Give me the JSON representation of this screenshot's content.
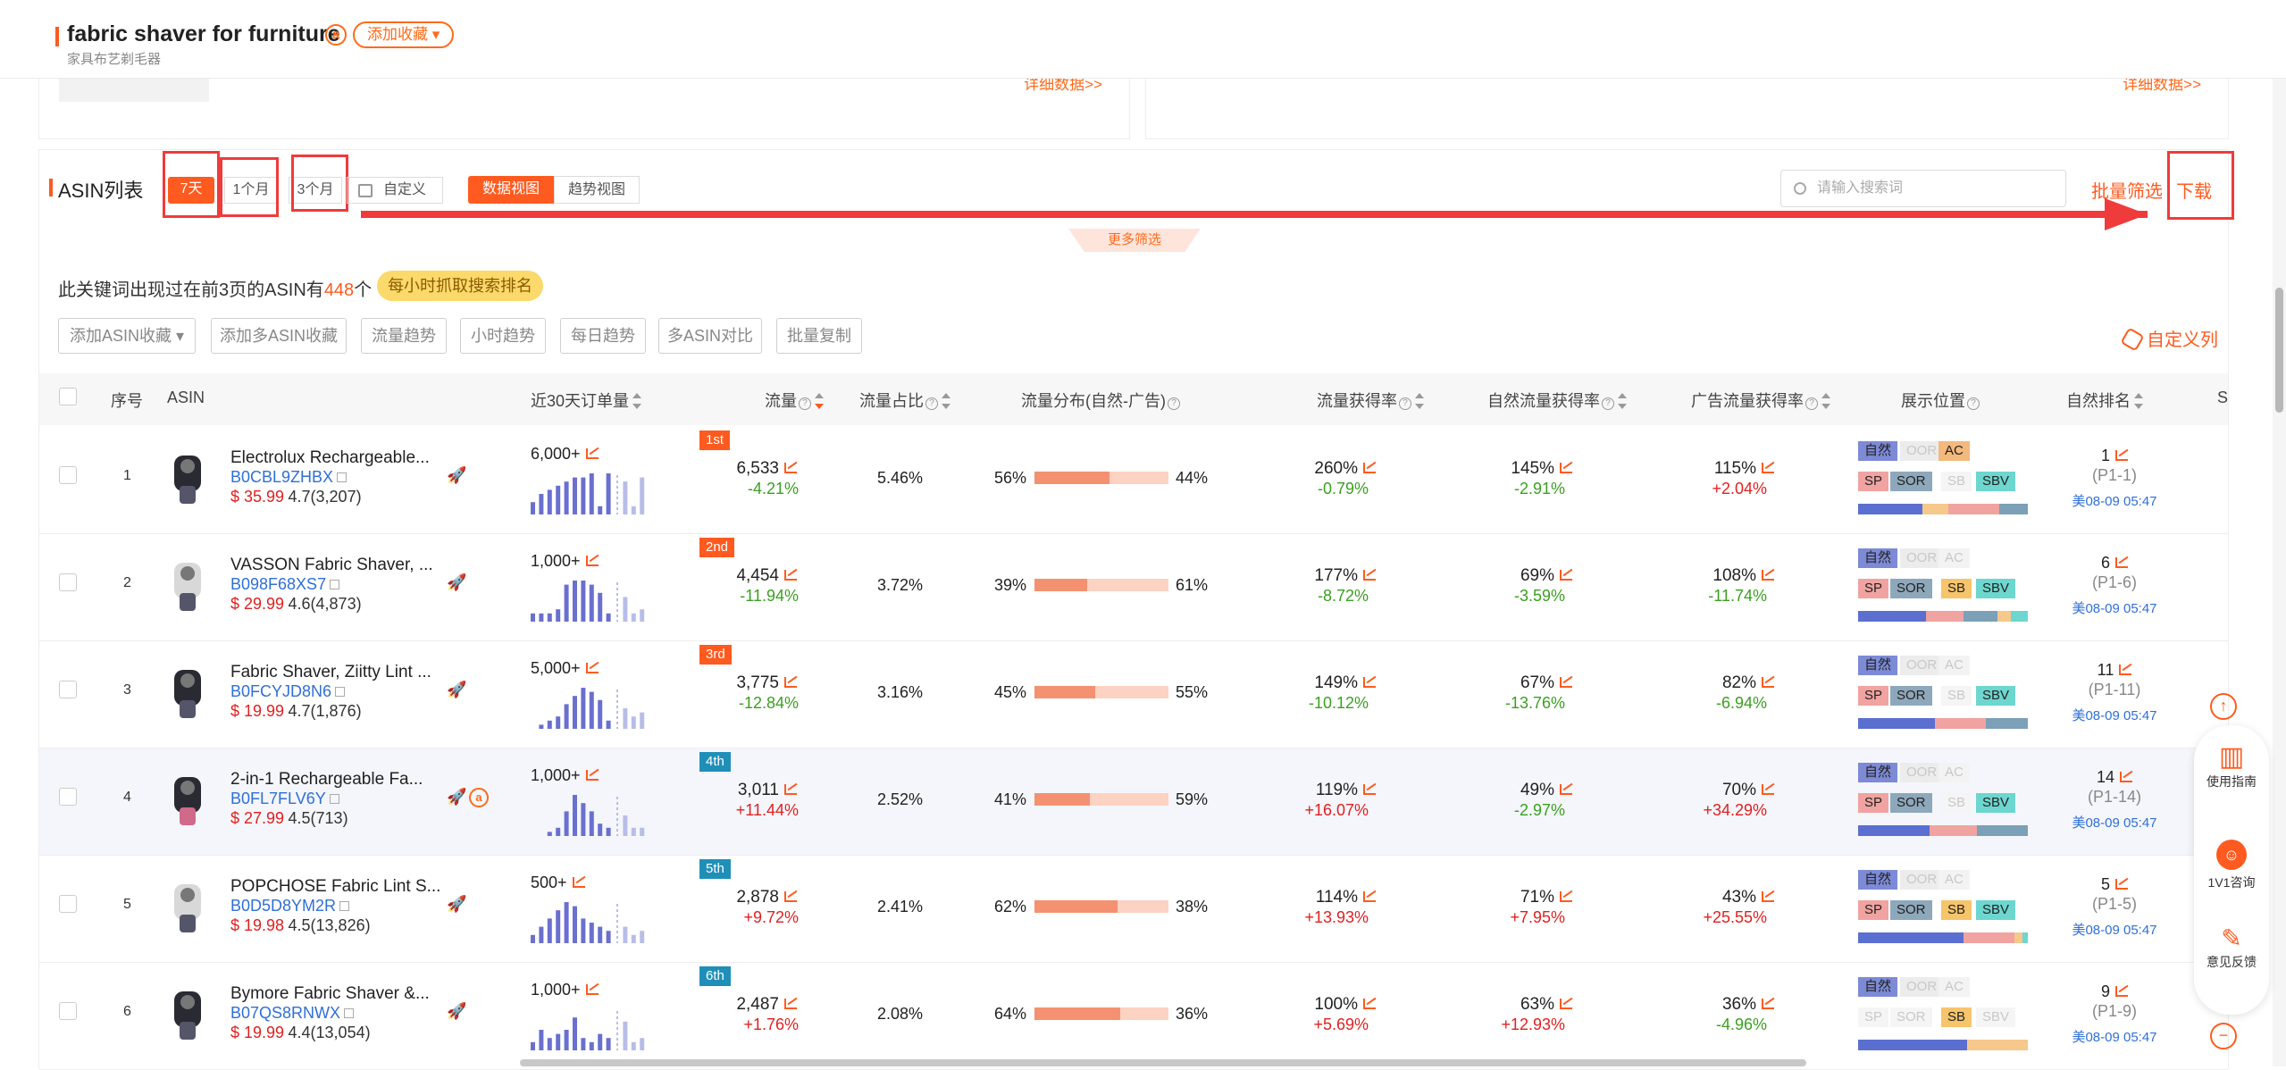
{
  "header": {
    "keyword": "fabric shaver for furniture",
    "badge": "a",
    "fav_label": "添加收藏",
    "subtitle": "家具布艺剃毛器"
  },
  "top_cards": {
    "detail_link": "详细数据>>"
  },
  "asin_section": {
    "title": "ASIN列表",
    "ranges": [
      "7天",
      "1个月",
      "3个月"
    ],
    "custom": "自定义",
    "views": [
      "数据视图",
      "趋势视图"
    ],
    "search_placeholder": "请输入搜索词",
    "bulk_filter": "批量筛选",
    "download": "下载",
    "more_filter": "更多筛选",
    "info_prefix": "此关键词出现过在前3页的ASIN有",
    "info_count": "448",
    "info_suffix": "个",
    "hourly_badge": "每小时抓取搜索排名",
    "actions": [
      "添加ASIN收藏",
      "添加多ASIN收藏",
      "流量趋势",
      "小时趋势",
      "每日趋势",
      "多ASIN对比",
      "批量复制"
    ],
    "custom_cols": "自定义列"
  },
  "columns": [
    "序号",
    "ASIN",
    "近30天订单量",
    "流量",
    "流量占比",
    "流量分布(自然-广告)",
    "流量获得率",
    "自然流量获得率",
    "广告流量获得率",
    "展示位置",
    "自然排名",
    "S"
  ],
  "position_tags": {
    "row1": [
      "自然",
      "OOR",
      "AC"
    ],
    "row2": [
      "SP",
      "SOR",
      "SB",
      "SBV"
    ]
  },
  "rows": [
    {
      "idx": "1",
      "title": "Electrolux Rechargeable...",
      "asin": "B0CBL9ZHBX",
      "price": "$ 35.99",
      "rating": "4.7(3,207)",
      "sales": "6,000+",
      "rank": "1st",
      "rank_color": "#ff5a1f",
      "traffic": "6,533",
      "traffic_chg": "-4.21%",
      "share": "5.46%",
      "dist_l": "56%",
      "dist_r": "44%",
      "dist_frac": 0.56,
      "r1": "260%",
      "r1c": "-0.79%",
      "r2": "145%",
      "r2c": "-2.91%",
      "r3": "115%",
      "r3c": "+2.04%",
      "nrank": "1",
      "np": "(P1-1)",
      "date": "美08-09 05:47",
      "bars": [
        3,
        5,
        6,
        7,
        8,
        9,
        9,
        10,
        2,
        10,
        0,
        8,
        2,
        9
      ],
      "tags_on": [
        1,
        0,
        1,
        1,
        1,
        0,
        1
      ],
      "pbar": [
        [
          "#5b6fd0",
          0.38
        ],
        [
          "#f6c88b",
          0.15
        ],
        [
          "#f0a3a0",
          0.3
        ],
        [
          "#7ba0b8",
          0.17
        ]
      ]
    },
    {
      "idx": "2",
      "title": "VASSON Fabric Shaver, ...",
      "asin": "B098F68XS7",
      "price": "$ 29.99",
      "rating": "4.6(4,873)",
      "sales": "1,000+",
      "rank": "2nd",
      "rank_color": "#ff5a1f",
      "traffic": "4,454",
      "traffic_chg": "-11.94%",
      "share": "3.72%",
      "dist_l": "39%",
      "dist_r": "61%",
      "dist_frac": 0.39,
      "r1": "177%",
      "r1c": "-8.72%",
      "r2": "69%",
      "r2c": "-3.59%",
      "r3": "108%",
      "r3c": "-11.74%",
      "nrank": "6",
      "np": "(P1-6)",
      "date": "美08-09 05:47",
      "bars": [
        2,
        2,
        2,
        3,
        9,
        10,
        10,
        9,
        7,
        2,
        0,
        6,
        2,
        3
      ],
      "tags_on": [
        1,
        0,
        0,
        1,
        1,
        1,
        1
      ],
      "pbar": [
        [
          "#5b6fd0",
          0.4
        ],
        [
          "#f0a3a0",
          0.22
        ],
        [
          "#7ba0b8",
          0.2
        ],
        [
          "#f6c88b",
          0.08
        ],
        [
          "#6dd6cf",
          0.1
        ]
      ]
    },
    {
      "idx": "3",
      "title": "Fabric Shaver, Ziitty Lint ...",
      "asin": "B0FCYJD8N6",
      "price": "$ 19.99",
      "rating": "4.7(1,876)",
      "sales": "5,000+",
      "rank": "3rd",
      "rank_color": "#ff5a1f",
      "traffic": "3,775",
      "traffic_chg": "-12.84%",
      "share": "3.16%",
      "dist_l": "45%",
      "dist_r": "55%",
      "dist_frac": 0.45,
      "r1": "149%",
      "r1c": "-10.12%",
      "r2": "67%",
      "r2c": "-13.76%",
      "r3": "82%",
      "r3c": "-6.94%",
      "nrank": "11",
      "np": "(P1-11)",
      "date": "美08-09 05:47",
      "bars": [
        0,
        1,
        2,
        3,
        6,
        8,
        10,
        9,
        7,
        2,
        0,
        5,
        3,
        4
      ],
      "tags_on": [
        1,
        0,
        0,
        1,
        1,
        0,
        1
      ],
      "pbar": [
        [
          "#5b6fd0",
          0.45
        ],
        [
          "#f0a3a0",
          0.3
        ],
        [
          "#7ba0b8",
          0.25
        ]
      ]
    },
    {
      "idx": "4",
      "title": "2-in-1 Rechargeable Fa...",
      "asin": "B0FL7FLV6Y",
      "price": "$ 27.99",
      "rating": "4.5(713)",
      "sales": "1,000+",
      "rank": "4th",
      "rank_color": "#1f8fb8",
      "traffic": "3,011",
      "traffic_chg": "+11.44%",
      "share": "2.52%",
      "dist_l": "41%",
      "dist_r": "59%",
      "dist_frac": 0.41,
      "r1": "119%",
      "r1c": "+16.07%",
      "r2": "49%",
      "r2c": "-2.97%",
      "r3": "70%",
      "r3c": "+34.29%",
      "nrank": "14",
      "np": "(P1-14)",
      "date": "美08-09 05:47",
      "bars": [
        0,
        0,
        1,
        2,
        6,
        10,
        8,
        6,
        3,
        2,
        0,
        5,
        2,
        2
      ],
      "tags_on": [
        1,
        0,
        0,
        1,
        1,
        0,
        1
      ],
      "pbar": [
        [
          "#5b6fd0",
          0.42
        ],
        [
          "#f0a3a0",
          0.28
        ],
        [
          "#7ba0b8",
          0.3
        ]
      ]
    },
    {
      "idx": "5",
      "title": "POPCHOSE Fabric Lint S...",
      "asin": "B0D5D8YM2R",
      "price": "$ 19.98",
      "rating": "4.5(13,826)",
      "sales": "500+",
      "rank": "5th",
      "rank_color": "#1f8fb8",
      "traffic": "2,878",
      "traffic_chg": "+9.72%",
      "share": "2.41%",
      "dist_l": "62%",
      "dist_r": "38%",
      "dist_frac": 0.62,
      "r1": "114%",
      "r1c": "+13.93%",
      "r2": "71%",
      "r2c": "+7.95%",
      "r3": "43%",
      "r3c": "+25.55%",
      "nrank": "5",
      "np": "(P1-5)",
      "date": "美08-09 05:47",
      "bars": [
        2,
        4,
        6,
        8,
        10,
        9,
        6,
        5,
        4,
        3,
        0,
        4,
        2,
        3
      ],
      "tags_on": [
        1,
        0,
        0,
        1,
        1,
        1,
        1
      ],
      "pbar": [
        [
          "#5b6fd0",
          0.62
        ],
        [
          "#f0a3a0",
          0.3
        ],
        [
          "#f6c88b",
          0.05
        ],
        [
          "#6dd6cf",
          0.03
        ]
      ]
    },
    {
      "idx": "6",
      "title": "Bymore Fabric Shaver &...",
      "asin": "B07QS8RNWX",
      "price": "$ 19.99",
      "rating": "4.4(13,054)",
      "sales": "1,000+",
      "rank": "6th",
      "rank_color": "#1f8fb8",
      "traffic": "2,487",
      "traffic_chg": "+1.76%",
      "share": "2.08%",
      "dist_l": "64%",
      "dist_r": "36%",
      "dist_frac": 0.64,
      "r1": "100%",
      "r1c": "+5.69%",
      "r2": "63%",
      "r2c": "+12.93%",
      "r3": "36%",
      "r3c": "-4.96%",
      "nrank": "9",
      "np": "(P1-9)",
      "date": "美08-09 05:47",
      "bars": [
        2,
        5,
        3,
        4,
        5,
        8,
        3,
        2,
        4,
        3,
        0,
        7,
        2,
        3
      ],
      "tags_on": [
        1,
        0,
        0,
        0,
        0,
        1,
        0
      ],
      "pbar": [
        [
          "#5b6fd0",
          0.64
        ],
        [
          "#f6c88b",
          0.36
        ]
      ]
    }
  ],
  "sidebar": {
    "guide": "使用指南",
    "consult": "1V1咨询",
    "feedback": "意见反馈"
  }
}
